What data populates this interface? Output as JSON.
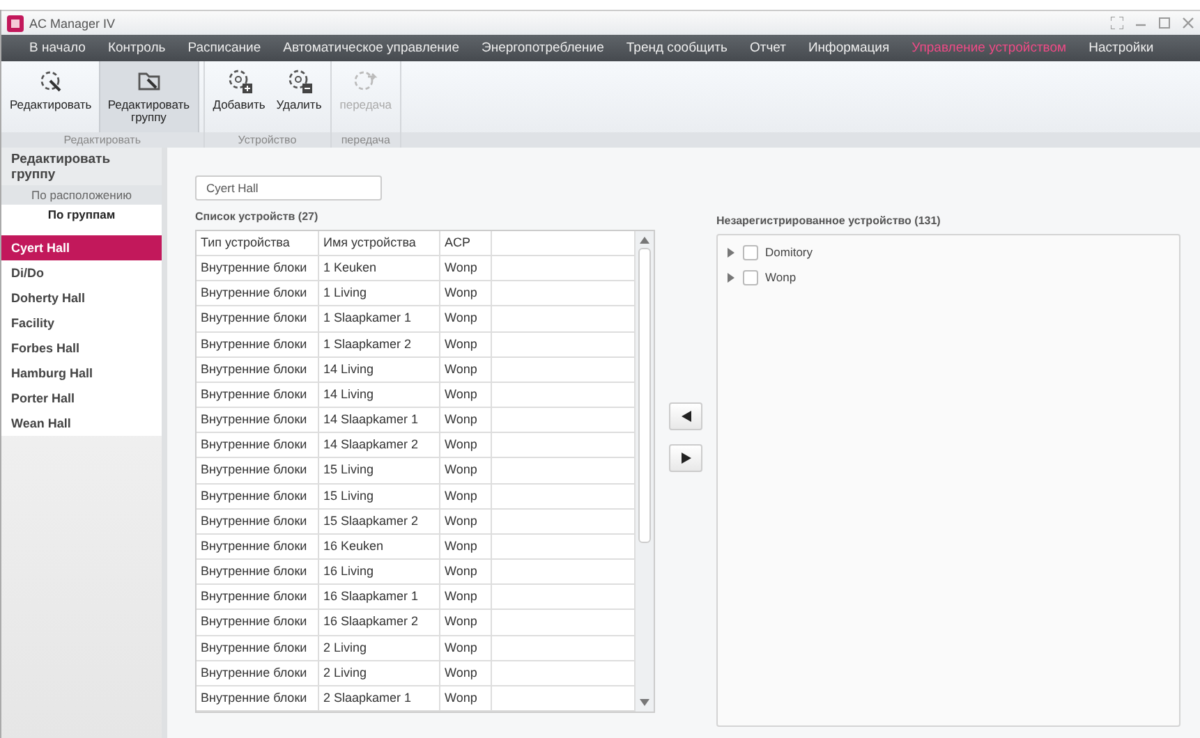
{
  "window": {
    "title": "AC Manager IV"
  },
  "menu": [
    {
      "label": "В начало",
      "selected": false
    },
    {
      "label": "Контроль",
      "selected": false
    },
    {
      "label": "Расписание",
      "selected": false
    },
    {
      "label": "Автоматическое управление",
      "selected": false
    },
    {
      "label": "Энергопотребление",
      "selected": false
    },
    {
      "label": "Тренд сообщить",
      "selected": false
    },
    {
      "label": "Отчет",
      "selected": false
    },
    {
      "label": "Информация",
      "selected": false
    },
    {
      "label": "Управление устройством",
      "selected": true
    },
    {
      "label": "Настройки",
      "selected": false
    }
  ],
  "ribbon": [
    {
      "label": "Редактировать",
      "buttons": [
        {
          "label": "Редактировать",
          "kind": "edit",
          "selected": false,
          "disabled": false
        },
        {
          "label": "Редактировать группу",
          "kind": "editgroup",
          "selected": true,
          "disabled": false
        }
      ]
    },
    {
      "label": "Устройство",
      "buttons": [
        {
          "label": "Добавить",
          "kind": "add",
          "selected": false,
          "disabled": false
        },
        {
          "label": "Удалить",
          "kind": "remove",
          "selected": false,
          "disabled": false
        }
      ]
    },
    {
      "label": "передача",
      "buttons": [
        {
          "label": "передача",
          "kind": "transfer",
          "selected": false,
          "disabled": true
        }
      ]
    }
  ],
  "sidebar": {
    "title": "Редактировать группу",
    "tabs": [
      {
        "label": "По расположению",
        "selected": false
      },
      {
        "label": "По группам",
        "selected": true
      }
    ],
    "items": [
      {
        "label": "Cyert Hall",
        "selected": true
      },
      {
        "label": "Di/Do",
        "selected": false
      },
      {
        "label": "Doherty Hall",
        "selected": false
      },
      {
        "label": "Facility",
        "selected": false
      },
      {
        "label": "Forbes Hall",
        "selected": false
      },
      {
        "label": "Hamburg Hall",
        "selected": false
      },
      {
        "label": "Porter Hall",
        "selected": false
      },
      {
        "label": "Wean Hall",
        "selected": false
      }
    ]
  },
  "group_name": {
    "value": "Cyert Hall"
  },
  "device_list": {
    "title": "Список устройств (27)",
    "columns": [
      "Тип устройства",
      "Имя устройства",
      "ACP"
    ],
    "rows": [
      [
        "Внутренние блоки",
        "1 Keuken",
        "Wonp"
      ],
      [
        "Внутренние блоки",
        "1 Living",
        "Wonp"
      ],
      [
        "Внутренние блоки",
        "1 Slaapkamer 1",
        "Wonp"
      ],
      [
        "Внутренние блоки",
        "1 Slaapkamer 2",
        "Wonp"
      ],
      [
        "Внутренние блоки",
        "14 Living",
        "Wonp"
      ],
      [
        "Внутренние блоки",
        "14 Living",
        "Wonp"
      ],
      [
        "Внутренние блоки",
        "14 Slaapkamer 1",
        "Wonp"
      ],
      [
        "Внутренние блоки",
        "14 Slaapkamer 2",
        "Wonp"
      ],
      [
        "Внутренние блоки",
        "15 Living",
        "Wonp"
      ],
      [
        "Внутренние блоки",
        "15 Living",
        "Wonp"
      ],
      [
        "Внутренние блоки",
        "15 Slaapkamer 2",
        "Wonp"
      ],
      [
        "Внутренние блоки",
        "16 Keuken",
        "Wonp"
      ],
      [
        "Внутренние блоки",
        "16 Living",
        "Wonp"
      ],
      [
        "Внутренние блоки",
        "16 Slaapkamer 1",
        "Wonp"
      ],
      [
        "Внутренние блоки",
        "16 Slaapkamer 2",
        "Wonp"
      ],
      [
        "Внутренние блоки",
        "2 Living",
        "Wonp"
      ],
      [
        "Внутренние блоки",
        "2 Living",
        "Wonp"
      ],
      [
        "Внутренние блоки",
        "2 Slaapkamer 1",
        "Wonp"
      ]
    ]
  },
  "unregistered": {
    "title": "Незарегистрированное устройство (131)",
    "tree": [
      {
        "label": "Domitory",
        "expanded": false,
        "checked": false
      },
      {
        "label": "Wonp",
        "expanded": false,
        "checked": false
      }
    ]
  }
}
